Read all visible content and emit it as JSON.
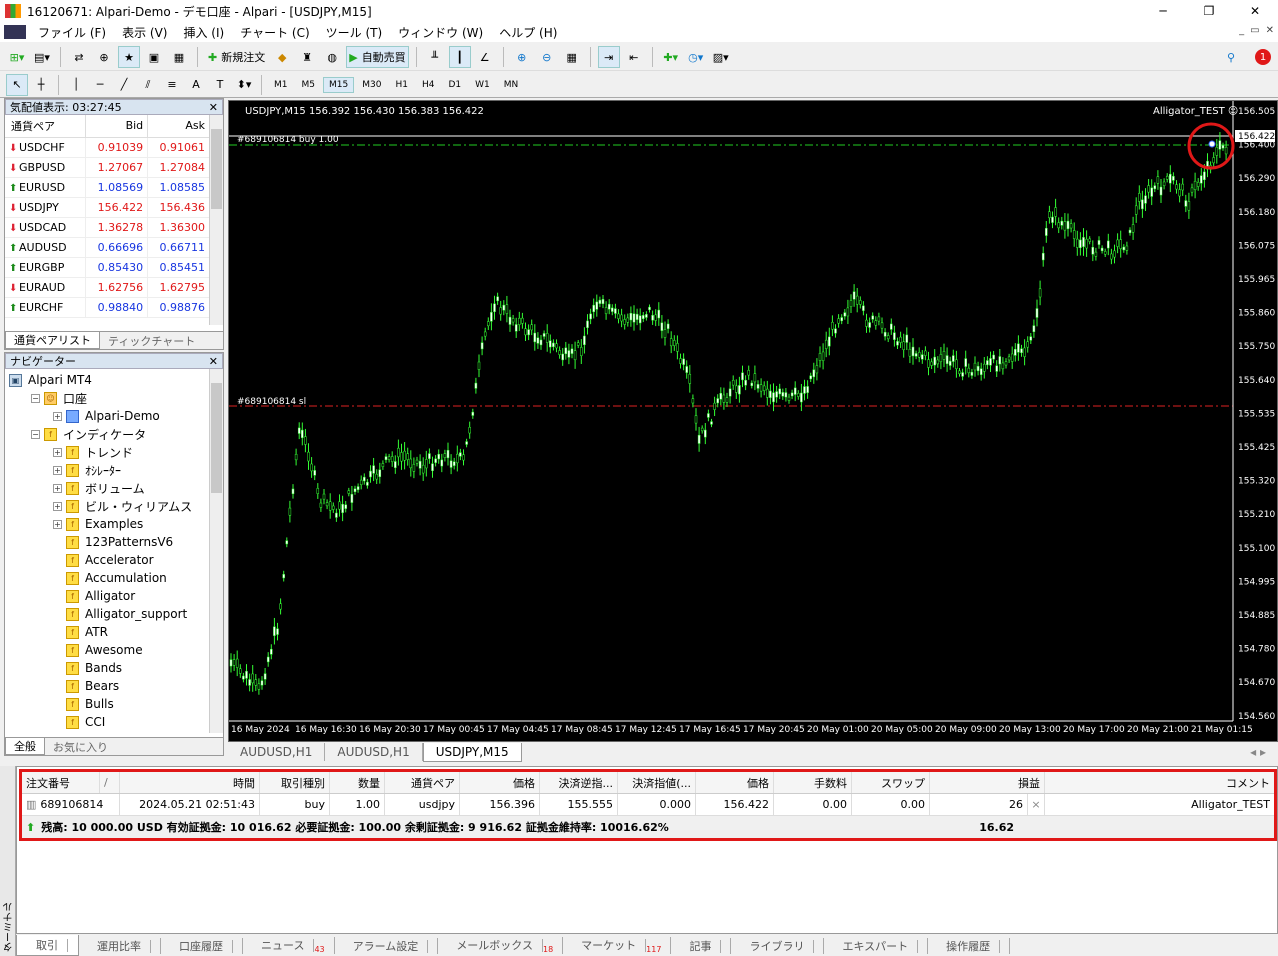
{
  "window": {
    "title": "16120671: Alpari-Demo - デモ口座 - Alpari - [USDJPY,M15]",
    "controls": [
      "─",
      "❐",
      "✕"
    ]
  },
  "menu": [
    "ファイル (F)",
    "表示 (V)",
    "挿入 (I)",
    "チャート (C)",
    "ツール (T)",
    "ウィンドウ (W)",
    "ヘルプ (H)"
  ],
  "toolbar": {
    "new_order": "新規注文",
    "auto_trade": "自動売買",
    "notif_count": "1"
  },
  "timeframes": [
    "M1",
    "M5",
    "M15",
    "M30",
    "H1",
    "H4",
    "D1",
    "W1",
    "MN"
  ],
  "market_watch": {
    "title": "気配値表示: 03:27:45",
    "headers": [
      "通貨ペア",
      "Bid",
      "Ask"
    ],
    "rows": [
      {
        "sym": "USDCHF",
        "dir": "dn",
        "bid": "0.91039",
        "ask": "0.91061",
        "color": "red"
      },
      {
        "sym": "GBPUSD",
        "dir": "dn",
        "bid": "1.27067",
        "ask": "1.27084",
        "color": "red"
      },
      {
        "sym": "EURUSD",
        "dir": "up",
        "bid": "1.08569",
        "ask": "1.08585",
        "color": "blue"
      },
      {
        "sym": "USDJPY",
        "dir": "dn",
        "bid": "156.422",
        "ask": "156.436",
        "color": "red"
      },
      {
        "sym": "USDCAD",
        "dir": "dn",
        "bid": "1.36278",
        "ask": "1.36300",
        "color": "red"
      },
      {
        "sym": "AUDUSD",
        "dir": "up",
        "bid": "0.66696",
        "ask": "0.66711",
        "color": "blue"
      },
      {
        "sym": "EURGBP",
        "dir": "up",
        "bid": "0.85430",
        "ask": "0.85451",
        "color": "blue"
      },
      {
        "sym": "EURAUD",
        "dir": "dn",
        "bid": "1.62756",
        "ask": "1.62795",
        "color": "red"
      },
      {
        "sym": "EURCHF",
        "dir": "up",
        "bid": "0.98840",
        "ask": "0.98876",
        "color": "blue"
      }
    ],
    "tabs": [
      "通貨ペアリスト",
      "ティックチャート"
    ]
  },
  "navigator": {
    "title": "ナビゲーター",
    "items": [
      {
        "label": "Alpari MT4",
        "level": 0,
        "exp": ""
      },
      {
        "label": "口座",
        "level": 1,
        "exp": "-"
      },
      {
        "label": "Alpari-Demo",
        "level": 2,
        "exp": "+"
      },
      {
        "label": "インディケータ",
        "level": 1,
        "exp": "-"
      },
      {
        "label": "トレンド",
        "level": 2,
        "exp": "+"
      },
      {
        "label": "ｵｼﾚｰﾀｰ",
        "level": 2,
        "exp": "+"
      },
      {
        "label": "ボリューム",
        "level": 2,
        "exp": "+"
      },
      {
        "label": "ビル・ウィリアムス",
        "level": 2,
        "exp": "+"
      },
      {
        "label": "Examples",
        "level": 2,
        "exp": "+"
      },
      {
        "label": "123PatternsV6",
        "level": 2,
        "exp": ""
      },
      {
        "label": "Accelerator",
        "level": 2,
        "exp": ""
      },
      {
        "label": "Accumulation",
        "level": 2,
        "exp": ""
      },
      {
        "label": "Alligator",
        "level": 2,
        "exp": ""
      },
      {
        "label": "Alligator_support",
        "level": 2,
        "exp": ""
      },
      {
        "label": "ATR",
        "level": 2,
        "exp": ""
      },
      {
        "label": "Awesome",
        "level": 2,
        "exp": ""
      },
      {
        "label": "Bands",
        "level": 2,
        "exp": ""
      },
      {
        "label": "Bears",
        "level": 2,
        "exp": ""
      },
      {
        "label": "Bulls",
        "level": 2,
        "exp": ""
      },
      {
        "label": "CCI",
        "level": 2,
        "exp": ""
      }
    ],
    "tabs": [
      "全般",
      "お気に入り"
    ]
  },
  "chart": {
    "header": "USDJPY,M15  156.392 156.430 156.383 156.422",
    "ea": "Alligator_TEST ☺",
    "current_price": "156.422",
    "buy_label": "#689106814 buy 1.00",
    "sl_label": "#689106814 sl",
    "y_ticks": [
      "156.505",
      "156.400",
      "156.290",
      "156.180",
      "156.075",
      "155.965",
      "155.860",
      "155.750",
      "155.640",
      "155.535",
      "155.425",
      "155.320",
      "155.210",
      "155.100",
      "154.995",
      "154.885",
      "154.780",
      "154.670",
      "154.560"
    ],
    "x_ticks": [
      "16 May 2024",
      "16 May 16:30",
      "16 May 20:30",
      "17 May 00:45",
      "17 May 04:45",
      "17 May 08:45",
      "17 May 12:45",
      "17 May 16:45",
      "17 May 20:45",
      "20 May 01:00",
      "20 May 05:00",
      "20 May 09:00",
      "20 May 13:00",
      "20 May 17:00",
      "20 May 21:00",
      "21 May 01:15"
    ],
    "tabs": [
      "AUDUSD,H1",
      "AUDUSD,H1",
      "USDJPY,M15"
    ]
  },
  "terminal": {
    "side_label": "ターミナル",
    "headers": [
      "注文番号",
      "/",
      "時間",
      "取引種別",
      "数量",
      "通貨ペア",
      "価格",
      "決済逆指...",
      "決済指値(...",
      "価格",
      "手数料",
      "スワップ",
      "損益",
      "コメント"
    ],
    "order": {
      "id": "689106814",
      "time": "2024.05.21 02:51:43",
      "type": "buy",
      "volume": "1.00",
      "symbol": "usdjpy",
      "price": "156.396",
      "sl": "155.555",
      "tp": "0.000",
      "cur": "156.422",
      "commission": "0.00",
      "swap": "0.00",
      "profit": "26",
      "close": "×",
      "comment": "Alligator_TEST"
    },
    "balance": "残高: 10 000.00 USD  有効証拠金: 10 016.62  必要証拠金: 100.00  余剰証拠金: 9 916.62  証拠金維持率: 10016.62%",
    "balance_profit": "16.62",
    "tabs": [
      {
        "label": "取引",
        "badge": ""
      },
      {
        "label": "運用比率",
        "badge": ""
      },
      {
        "label": "口座履歴",
        "badge": ""
      },
      {
        "label": "ニュース",
        "badge": "43"
      },
      {
        "label": "アラーム設定",
        "badge": ""
      },
      {
        "label": "メールボックス",
        "badge": "18"
      },
      {
        "label": "マーケット",
        "badge": "117"
      },
      {
        "label": "記事",
        "badge": ""
      },
      {
        "label": "ライブラリ",
        "badge": ""
      },
      {
        "label": "エキスパート",
        "badge": ""
      },
      {
        "label": "操作履歴",
        "badge": ""
      }
    ]
  }
}
